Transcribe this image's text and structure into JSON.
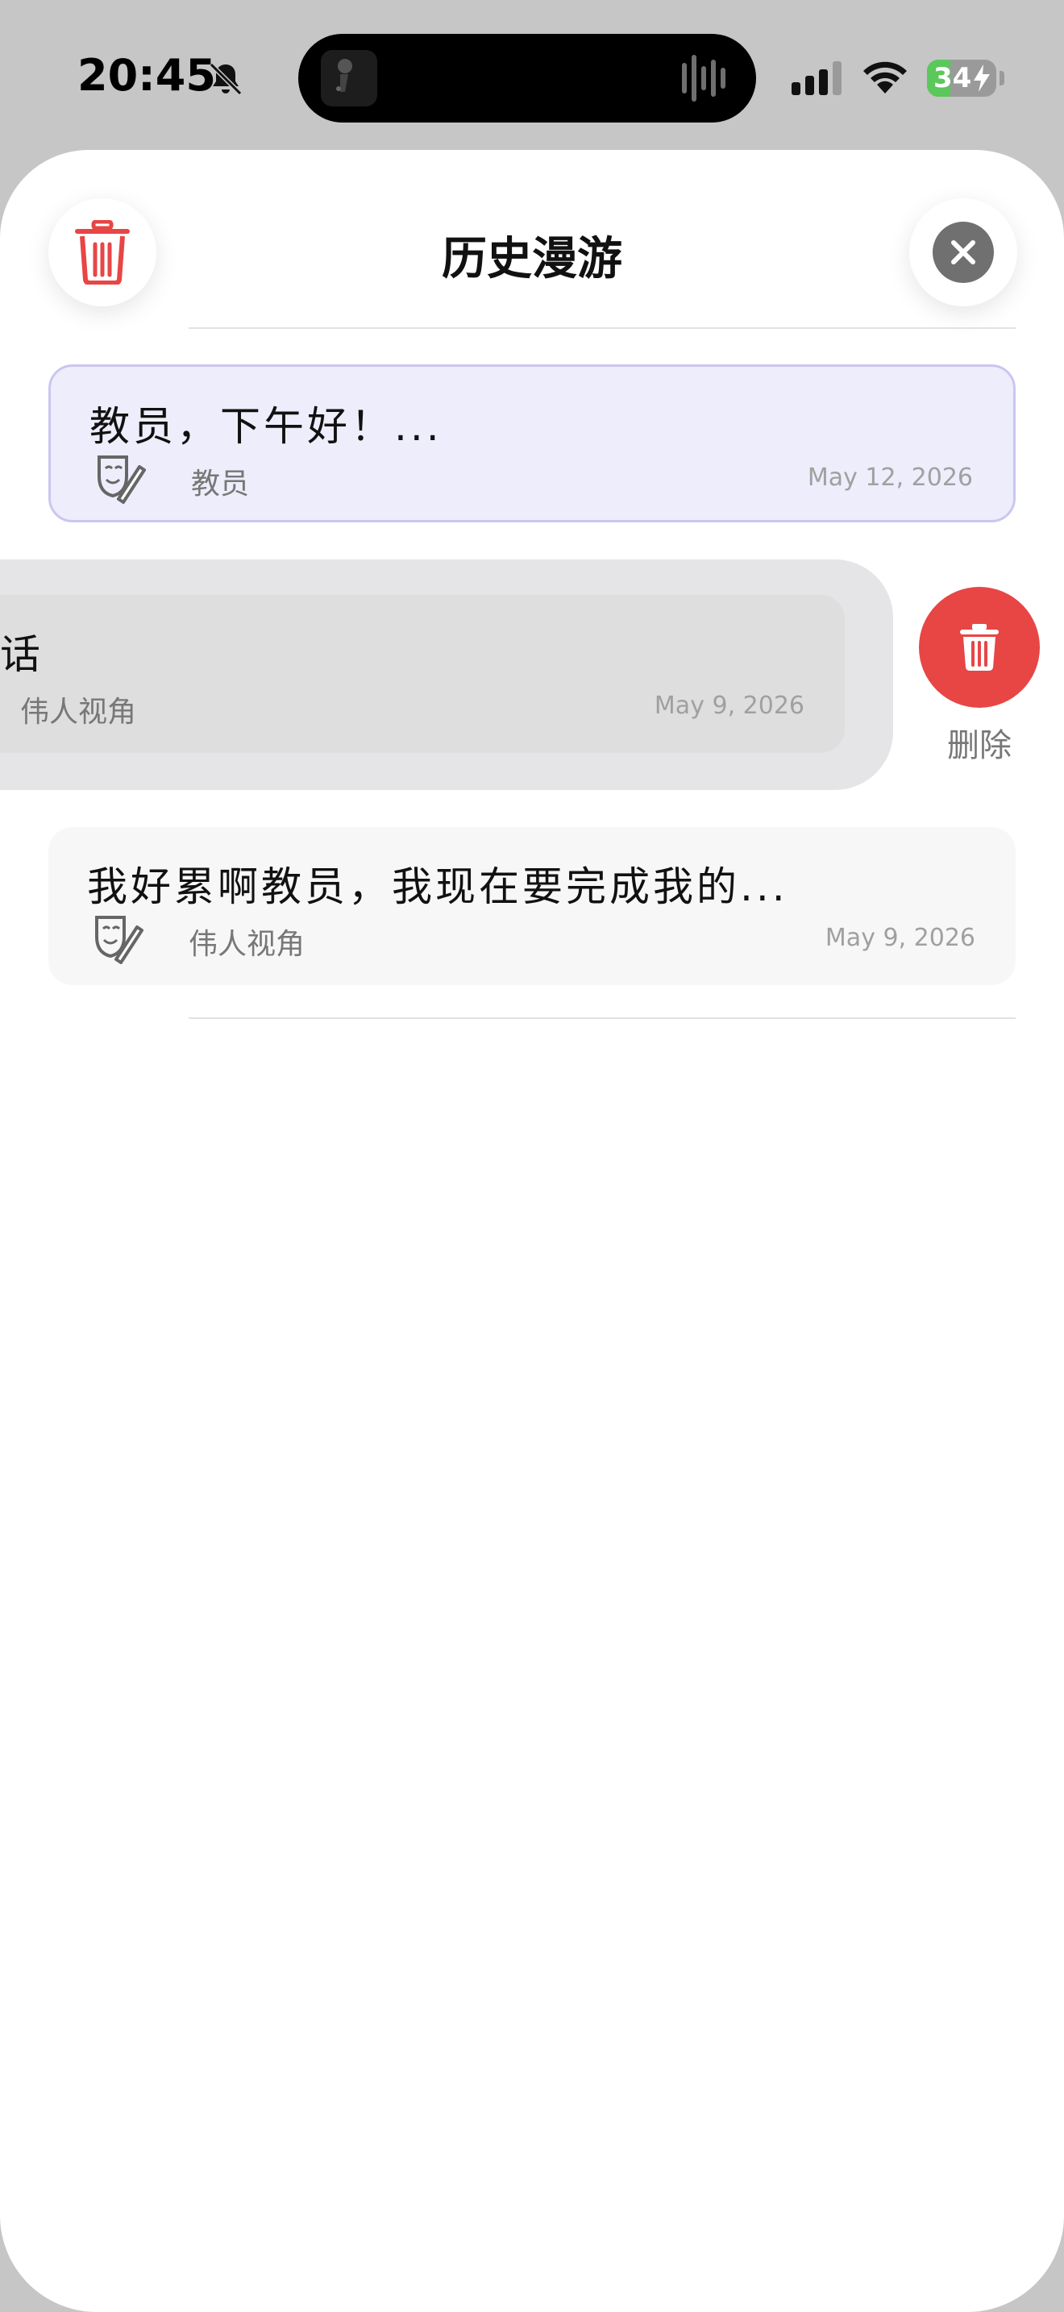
{
  "status_bar": {
    "time": "20:45",
    "battery_level": "34",
    "battery_fraction": 0.34,
    "icons": [
      "bell-slash-icon",
      "cellular-signal-icon",
      "wifi-icon",
      "battery-charging-icon"
    ]
  },
  "header": {
    "title": "历史漫游",
    "clear_icon": "trash-icon",
    "close_icon": "close-icon",
    "accent_color": "#e84545"
  },
  "history": [
    {
      "title": "教员，下午好！...",
      "role": "教员",
      "date": "May 12, 2026",
      "icon": "theater-masks-icon",
      "selected": true
    },
    {
      "title": "话",
      "role": "伟人视角",
      "date": "May 9, 2026",
      "icon": "theater-masks-icon",
      "swiped": true
    },
    {
      "title": "我好累啊教员，我现在要完成我的...",
      "role": "伟人视角",
      "date": "May 9, 2026",
      "icon": "theater-masks-icon"
    }
  ],
  "swipe_action": {
    "label": "删除",
    "icon": "trash-icon",
    "color": "#e84545"
  }
}
